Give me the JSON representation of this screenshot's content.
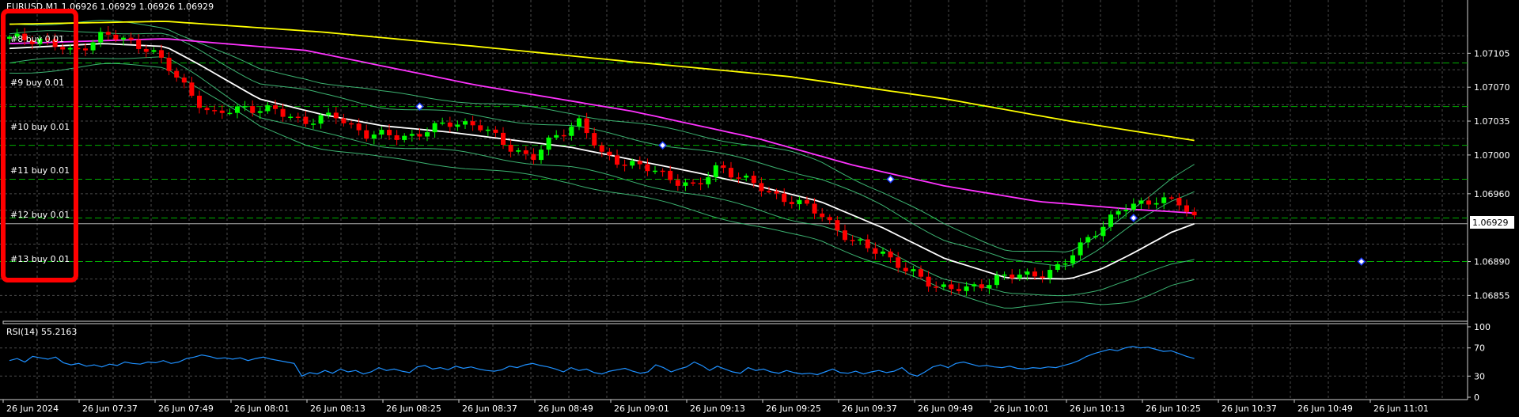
{
  "symbol_header": "EURUSD,M1  1.06926 1.06929 1.06926 1.06929",
  "current_price": "1.06929",
  "orders": [
    "#8 buy 0.01",
    "#9 buy 0.01",
    "#10 buy 0.01",
    "#11 buy 0.01",
    "#12 buy 0.01",
    "#13 buy 0.01"
  ],
  "rsi_header": "RSI(14) 55.2163",
  "colors": {
    "background": "#000000",
    "grid": "#4a4a4a",
    "bull_candle": "#00ff00",
    "bear_candle": "#ff0000",
    "ma_fast": "#ffffff",
    "ma_mid": "#ff33ff",
    "ma_slow": "#ffff00",
    "bands": "#3cb371",
    "order_lines": "#00b000",
    "rsi_line": "#1e90ff",
    "highlight_box": "#ff0000"
  },
  "chart_data": [
    {
      "type": "candlestick",
      "title": "EURUSD,M1  1.06926 1.06929 1.06926 1.06929",
      "ylim": [
        1.0683,
        1.0716
      ],
      "y_ticks": [
        "1.07105",
        "1.07070",
        "1.07035",
        "1.07000",
        "1.06960",
        "1.06890",
        "1.06855"
      ],
      "x_ticks": [
        "26 Jun 2024",
        "26 Jun 07:37",
        "26 Jun 07:49",
        "26 Jun 08:01",
        "26 Jun 08:13",
        "26 Jun 08:25",
        "26 Jun 08:37",
        "26 Jun 08:49",
        "26 Jun 09:01",
        "26 Jun 09:13",
        "26 Jun 09:25",
        "26 Jun 09:37",
        "26 Jun 09:49",
        "26 Jun 10:01",
        "26 Jun 10:13",
        "26 Jun 10:25",
        "26 Jun 10:37",
        "26 Jun 10:49",
        "26 Jun 11:01"
      ],
      "last_price": 1.06929,
      "order_levels": [
        1.07095,
        1.0705,
        1.0701,
        1.06975,
        1.06935,
        1.0689
      ],
      "close_path": [
        [
          0,
          1.0712
        ],
        [
          20,
          1.0712
        ],
        [
          40,
          1.07105
        ],
        [
          60,
          1.07125
        ],
        [
          90,
          1.0711
        ],
        [
          110,
          1.07075
        ],
        [
          130,
          1.0704
        ],
        [
          150,
          1.0705
        ],
        [
          170,
          1.07045
        ],
        [
          190,
          1.07035
        ],
        [
          210,
          1.0704
        ],
        [
          230,
          1.0702
        ],
        [
          260,
          1.0702
        ],
        [
          285,
          1.07035
        ],
        [
          300,
          1.0703
        ],
        [
          320,
          1.0701
        ],
        [
          335,
          1.06995
        ],
        [
          350,
          1.0702
        ],
        [
          365,
          1.07035
        ],
        [
          380,
          1.07
        ],
        [
          400,
          1.0699
        ],
        [
          420,
          1.0698
        ],
        [
          440,
          1.06965
        ],
        [
          455,
          1.0699
        ],
        [
          470,
          1.06975
        ],
        [
          490,
          1.0696
        ],
        [
          520,
          1.0694
        ],
        [
          540,
          1.0691
        ],
        [
          560,
          1.069
        ],
        [
          575,
          1.0688
        ],
        [
          595,
          1.06865
        ],
        [
          615,
          1.0686
        ],
        [
          635,
          1.06875
        ],
        [
          655,
          1.06875
        ],
        [
          675,
          1.06885
        ],
        [
          695,
          1.0692
        ],
        [
          715,
          1.06945
        ],
        [
          735,
          1.06955
        ],
        [
          750,
          1.0695
        ],
        [
          760,
          1.06935
        ]
      ],
      "ma_fast": [
        [
          0,
          1.0711
        ],
        [
          60,
          1.07115
        ],
        [
          100,
          1.07112
        ],
        [
          120,
          1.07095
        ],
        [
          160,
          1.07058
        ],
        [
          200,
          1.07042
        ],
        [
          240,
          1.0703
        ],
        [
          280,
          1.07024
        ],
        [
          320,
          1.07016
        ],
        [
          360,
          1.07008
        ],
        [
          400,
          1.06995
        ],
        [
          440,
          1.06982
        ],
        [
          480,
          1.06968
        ],
        [
          520,
          1.06952
        ],
        [
          560,
          1.06925
        ],
        [
          600,
          1.06893
        ],
        [
          640,
          1.06873
        ],
        [
          680,
          1.06872
        ],
        [
          700,
          1.06882
        ],
        [
          720,
          1.06898
        ],
        [
          745,
          1.0692
        ],
        [
          760,
          1.06929
        ]
      ],
      "ma_mid": [
        [
          0,
          1.07115
        ],
        [
          100,
          1.0712
        ],
        [
          190,
          1.07108
        ],
        [
          300,
          1.07072
        ],
        [
          400,
          1.07045
        ],
        [
          480,
          1.07017
        ],
        [
          540,
          1.0699
        ],
        [
          600,
          1.06968
        ],
        [
          660,
          1.06952
        ],
        [
          720,
          1.06944
        ],
        [
          760,
          1.0694
        ]
      ],
      "ma_slow": [
        [
          0,
          1.07135
        ],
        [
          100,
          1.07138
        ],
        [
          200,
          1.07127
        ],
        [
          300,
          1.07112
        ],
        [
          400,
          1.07096
        ],
        [
          500,
          1.07081
        ],
        [
          600,
          1.07058
        ],
        [
          680,
          1.07035
        ],
        [
          760,
          1.07015
        ]
      ],
      "band_half_width": [
        [
          0,
          0.00015
        ],
        [
          100,
          0.00012
        ],
        [
          190,
          0.0002
        ],
        [
          300,
          0.0002
        ],
        [
          400,
          0.00022
        ],
        [
          500,
          0.00025
        ],
        [
          600,
          0.0002
        ],
        [
          680,
          0.00015
        ],
        [
          720,
          0.00028
        ],
        [
          760,
          0.00035
        ]
      ]
    },
    {
      "type": "line",
      "title": "RSI(14) 55.2163",
      "ylim": [
        0,
        100
      ],
      "y_ticks": [
        "100",
        "70",
        "30",
        "0"
      ],
      "levels": [
        70,
        30
      ],
      "values": [
        52,
        55,
        50,
        58,
        56,
        54,
        57,
        49,
        46,
        48,
        44,
        46,
        43,
        47,
        45,
        50,
        48,
        47,
        50,
        49,
        52,
        48,
        50,
        55,
        57,
        60,
        58,
        55,
        56,
        54,
        56,
        52,
        55,
        57,
        54,
        52,
        50,
        48,
        30,
        35,
        33,
        38,
        34,
        40,
        36,
        38,
        33,
        36,
        42,
        38,
        40,
        37,
        35,
        43,
        45,
        40,
        42,
        39,
        44,
        41,
        43,
        40,
        38,
        37,
        39,
        44,
        42,
        46,
        48,
        45,
        43,
        40,
        36,
        42,
        38,
        40,
        35,
        33,
        37,
        39,
        41,
        37,
        34,
        36,
        46,
        42,
        36,
        40,
        43,
        50,
        45,
        38,
        44,
        40,
        36,
        34,
        42,
        38,
        40,
        36,
        34,
        38,
        35,
        33,
        34,
        32,
        36,
        40,
        35,
        34,
        37,
        33,
        36,
        38,
        35,
        37,
        42,
        33,
        30,
        36,
        43,
        46,
        42,
        48,
        50,
        47,
        44,
        45,
        43,
        42,
        44,
        41,
        40,
        42,
        41,
        43,
        42,
        45,
        48,
        52,
        58,
        62,
        65,
        68,
        66,
        70,
        72,
        70,
        71,
        68,
        65,
        66,
        62,
        58,
        55
      ]
    }
  ]
}
